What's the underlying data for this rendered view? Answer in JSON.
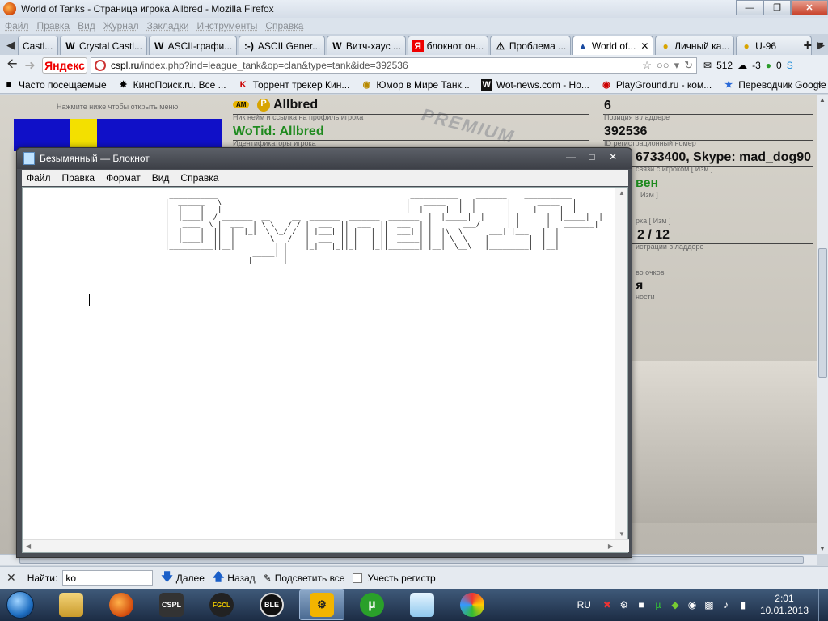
{
  "browser": {
    "title": "World of Tanks - Страница игрока Allbred - Mozilla Firefox",
    "menu": [
      "Файл",
      "Правка",
      "Вид",
      "Журнал",
      "Закладки",
      "Инструменты",
      "Справка"
    ],
    "tabs": [
      {
        "label": "Castl...",
        "icon": "tab-icon-generic"
      },
      {
        "label": "Crystal Castl...",
        "icon": "wikipedia-icon"
      },
      {
        "label": "ASCII-графи...",
        "icon": "wikipedia-icon"
      },
      {
        "label": "ASCII Gener...",
        "icon": "smiley-icon"
      },
      {
        "label": "Витч-хаус ...",
        "icon": "wikipedia-icon"
      },
      {
        "label": "блокнот он...",
        "icon": "yandex-icon"
      },
      {
        "label": "Проблема ...",
        "icon": "warning-icon"
      },
      {
        "label": "World of...",
        "icon": "wot-icon",
        "active": true
      },
      {
        "label": "Личный ка...",
        "icon": "beeline-icon"
      },
      {
        "label": "U-96",
        "icon": "beeline-icon"
      }
    ],
    "yandex_label": "Яндекс",
    "url_domain": "cspl.ru",
    "url_path": "/index.php?ind=league_tank&op=clan&type=tank&ide=392536",
    "mail_count": "512",
    "weather": "-3",
    "counter": "0",
    "bookmarks": [
      {
        "label": "Часто посещаемые",
        "icon": "bookmark-folder-icon"
      },
      {
        "label": "КиноПоиск.ru. Все ...",
        "icon": "kinopoisk-icon"
      },
      {
        "label": "Торрент трекер Кин...",
        "icon": "kinozal-icon"
      },
      {
        "label": "Юмор в Мире Танк...",
        "icon": "tank-humor-icon"
      },
      {
        "label": "Wot-news.com - Но...",
        "icon": "wot-news-icon"
      },
      {
        "label": "PlayGround.ru - ком...",
        "icon": "playground-icon"
      },
      {
        "label": "Переводчик Google",
        "icon": "translate-icon"
      }
    ]
  },
  "page": {
    "menu_hint": "Нажмите ниже чтобы открыть меню",
    "nick": "Allbred",
    "nick_sub": "Ник нейм и ссылка на профиль игрока",
    "wotid": "WoTid: Allbred",
    "wotid_sub": "Идентификаторы игрока",
    "rank": "6",
    "rank_sub": "Позиция в ладдере",
    "reg_id": "392536",
    "reg_id_sub": "ID регистрационный номер",
    "contact": "6733400, Skype: mad_dog90",
    "contact_sub": "связи с игроком",
    "contact_edit": "[ Изм ]",
    "status": "вен",
    "status_edit": "Изм ]",
    "type_sub": "рка",
    "type_edit": "[ Изм ]",
    "reg_count": "2 / 12",
    "reg_count_sub": "истрации в ладдере",
    "points_sub": "во очков",
    "level_value": "я",
    "level_sub": "ности",
    "premium": "PREMIUM",
    "tags": [
      "AM",
      "P"
    ]
  },
  "notepad": {
    "title": "Безымянный — Блокнот",
    "menu": [
      "Файл",
      "Правка",
      "Формат",
      "Вид",
      "Справка"
    ],
    "ascii_art": " ___________                                            ___________    _______    ___________ \n|  ______   \\                                          |   _____   |  |       |  |   _____   |\n|  |    |   |                                          |  |     |  |  |___ ___|  |  |     |  |\n|  |____|  / _______  __     __  _______  _______  _______  |  |_____|  |     | |      |  |_____|  |\n|   ____  \\ |  ___  | \\ \\   / / |  ___  ||  ___  ||  ___  | |       ___/      | |      |   _______|\n|  |    |  ||  |  |_|  \\ \\_/ /  | |___| || |   | || |___| | |  |\\  \\      ___| |___   |  |        \n|  |____|  ||  |        \\   /   |  ___  || |   | ||  _____| |  | \\  \\    |         |  |  |        \n|__________||__|         | |    |_|   |_||_|   |_||_______| |__|  \\__\\   |_________|  |__|        \n                    _____| |                                                                     \n                   |_______|                                                                     ",
    "text_hint": "Bryane RIP"
  },
  "findbar": {
    "label": "Найти:",
    "value": "ko",
    "next": "Далее",
    "prev": "Назад",
    "highlight": "Подсветить все",
    "match_case": "Учесть регистр"
  },
  "taskbar": {
    "apps": [
      {
        "name": "explorer-icon",
        "label": ""
      },
      {
        "name": "firefox-icon",
        "label": ""
      },
      {
        "name": "cspl-icon",
        "label": "CSPL"
      },
      {
        "name": "fgcl-icon",
        "label": "FGCL"
      },
      {
        "name": "ble-icon",
        "label": "BLE"
      },
      {
        "name": "steam-icon",
        "label": ""
      },
      {
        "name": "utorrent-icon",
        "label": "µ"
      },
      {
        "name": "notepad-icon",
        "label": ""
      },
      {
        "name": "paint-icon",
        "label": ""
      }
    ],
    "lang": "RU",
    "time": "2:01",
    "date": "10.01.2013"
  }
}
